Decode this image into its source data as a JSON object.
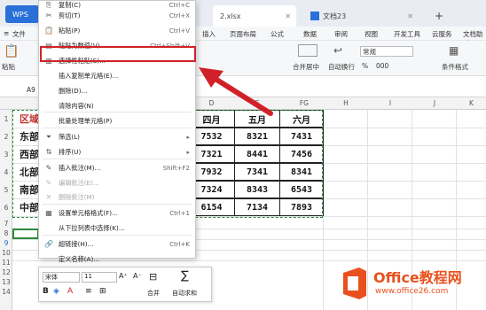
{
  "titlebar": {
    "wps_label": "WPS",
    "tab_file": "2.xlsx",
    "tab_doc": "文档23",
    "new_tab": "+",
    "win_min": "—",
    "win_max": "▢",
    "win_close": "✕"
  },
  "ribbon_tabs": [
    "文件",
    "插入",
    "页面布局",
    "公式",
    "数据",
    "审阅",
    "视图",
    "开发工具",
    "云服务",
    "文档助手"
  ],
  "ribbon": {
    "paste": "粘贴",
    "merge_center": "合并居中",
    "auto_wrap": "自动换行",
    "number_format": "常规",
    "conditional_format": "条件格式",
    "percent": "%",
    "thousand": "000"
  },
  "name_box": "A9",
  "columns": [
    "D",
    "E",
    "F",
    "G",
    "H",
    "I",
    "J",
    "K"
  ],
  "rows": [
    "1",
    "2",
    "3",
    "4",
    "5",
    "6",
    "7",
    "8",
    "9",
    "10",
    "11",
    "12",
    "13",
    "14"
  ],
  "left_cells": [
    "区域",
    "东部",
    "西部",
    "北部",
    "南部",
    "中部"
  ],
  "table": {
    "headers": [
      "四月",
      "五月",
      "六月"
    ],
    "rows": [
      [
        "7532",
        "8321",
        "7431"
      ],
      [
        "7321",
        "8441",
        "7456"
      ],
      [
        "7932",
        "7341",
        "8341"
      ],
      [
        "7324",
        "8343",
        "6543"
      ],
      [
        "6154",
        "7134",
        "7893"
      ]
    ]
  },
  "menu": [
    {
      "icon": "copy-icon",
      "glyph": "⎘",
      "label": "复制(C)",
      "shortcut": "Ctrl+C",
      "disabled": false
    },
    {
      "icon": "cut-icon",
      "glyph": "✂",
      "label": "剪切(T)",
      "shortcut": "Ctrl+X",
      "disabled": false
    },
    {
      "icon": "paste-icon",
      "glyph": "📋",
      "label": "粘贴(P)",
      "shortcut": "Ctrl+V",
      "disabled": false
    },
    {
      "icon": "paste-values-icon",
      "glyph": "▤",
      "label": "粘贴为数值(V)",
      "shortcut": "Ctrl+Shift+V",
      "disabled": false
    },
    {
      "icon": "paste-special-icon",
      "glyph": "▥",
      "label": "选择性粘贴(S)...",
      "shortcut": "",
      "disabled": false
    },
    {
      "icon": "",
      "glyph": "",
      "label": "插入复制单元格(E)...",
      "shortcut": "",
      "disabled": false
    },
    {
      "icon": "",
      "glyph": "",
      "label": "删除(D)...",
      "shortcut": "",
      "disabled": false
    },
    {
      "icon": "",
      "glyph": "",
      "label": "清除内容(N)",
      "shortcut": "",
      "disabled": false
    },
    {
      "icon": "",
      "glyph": "",
      "label": "批量处理单元格(P)",
      "shortcut": "",
      "disabled": false
    },
    {
      "icon": "filter-icon",
      "glyph": "⏷",
      "label": "筛选(L)",
      "shortcut": "▸",
      "disabled": false
    },
    {
      "icon": "sort-icon",
      "glyph": "⇅",
      "label": "排序(U)",
      "shortcut": "▸",
      "disabled": false
    },
    {
      "icon": "comment-icon",
      "glyph": "✎",
      "label": "插入批注(M)...",
      "shortcut": "Shift+F2",
      "disabled": false
    },
    {
      "icon": "edit-comment-icon",
      "glyph": "✎",
      "label": "编辑批注(E)...",
      "shortcut": "",
      "disabled": true
    },
    {
      "icon": "delete-comment-icon",
      "glyph": "✕",
      "label": "删除批注(M)",
      "shortcut": "",
      "disabled": true
    },
    {
      "icon": "format-cells-icon",
      "glyph": "▦",
      "label": "设置单元格格式(F)...",
      "shortcut": "Ctrl+1",
      "disabled": false
    },
    {
      "icon": "",
      "glyph": "",
      "label": "从下拉列表中选择(K)...",
      "shortcut": "",
      "disabled": false
    },
    {
      "icon": "hyperlink-icon",
      "glyph": "🔗",
      "label": "超链接(H)...",
      "shortcut": "Ctrl+K",
      "disabled": false
    },
    {
      "icon": "",
      "glyph": "",
      "label": "定义名称(A)...",
      "shortcut": "",
      "disabled": false
    }
  ],
  "mini_toolbar": {
    "font": "宋体",
    "size": "11",
    "grow": "A⁺",
    "shrink": "A⁻",
    "merge": "合并",
    "autosum": "自动求和",
    "bold": "B"
  },
  "watermark": {
    "brand": "Office教程网",
    "url": "www.office26.com"
  },
  "colors": {
    "highlight": "#d12128",
    "arrow": "#d12128",
    "dash": "#2e8b3a",
    "logo": "#e8511e"
  }
}
